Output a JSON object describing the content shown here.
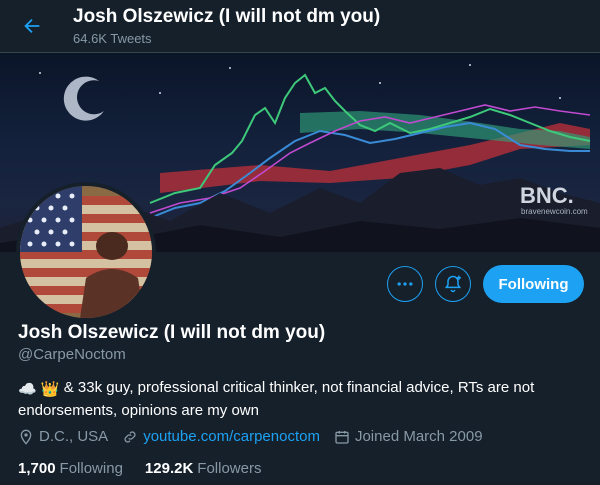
{
  "header": {
    "title": "Josh Olszewicz (I will not dm you)",
    "tweets_count": "64.6K Tweets"
  },
  "banner": {
    "watermark": "BNC.",
    "watermark_sub": "bravenewcoin.com"
  },
  "actions": {
    "more_icon": "more-icon",
    "notify_icon": "bell-plus-icon",
    "follow_label": "Following"
  },
  "profile": {
    "name": "Josh Olszewicz (I will not dm you)",
    "handle": "@CarpeNoctom",
    "bio_emojis": [
      "☁️",
      "👑"
    ],
    "bio": "& 33k guy, professional critical thinker, not financial advice, RTs are not endorsements, opinions are my own",
    "location": "D.C., USA",
    "website": "youtube.com/carpenoctom",
    "joined": "Joined March 2009"
  },
  "stats": {
    "following_count": "1,700",
    "following_label": "Following",
    "followers_count": "129.2K",
    "followers_label": "Followers"
  },
  "colors": {
    "background": "#15202b",
    "accent": "#1da1f2",
    "muted": "#8899a6"
  }
}
